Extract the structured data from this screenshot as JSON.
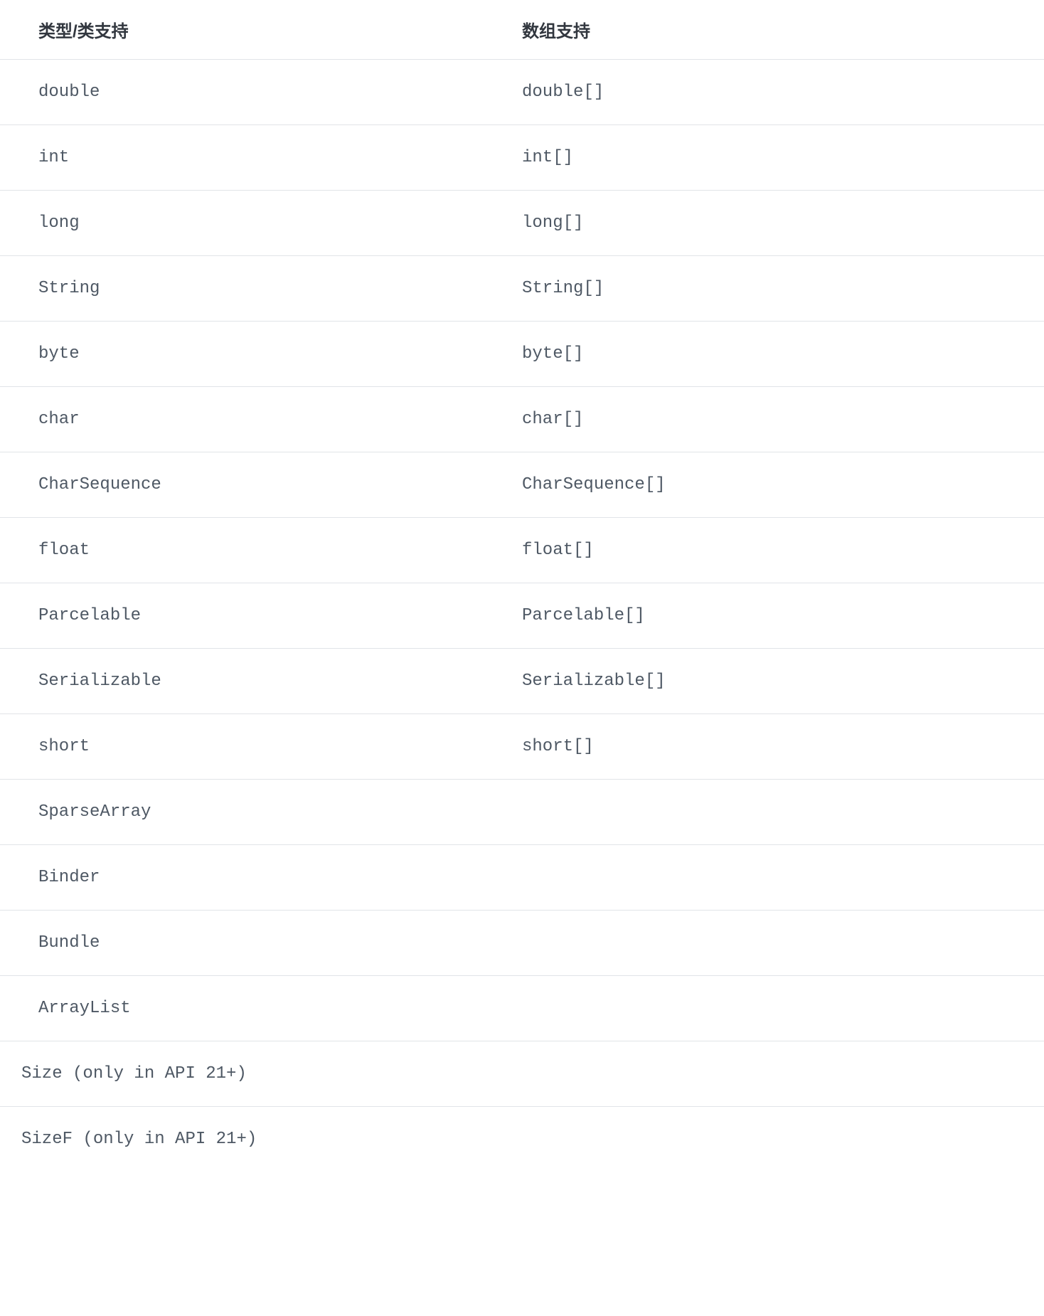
{
  "table": {
    "headers": {
      "type": "类型/类支持",
      "array": "数组支持"
    },
    "rows": [
      {
        "type": "double",
        "array": "double[]"
      },
      {
        "type": "int",
        "array": "int[]"
      },
      {
        "type": "long",
        "array": "long[]"
      },
      {
        "type": "String",
        "array": "String[]"
      },
      {
        "type": "byte",
        "array": "byte[]"
      },
      {
        "type": "char",
        "array": "char[]"
      },
      {
        "type": "CharSequence",
        "array": "CharSequence[]"
      },
      {
        "type": "float",
        "array": "float[]"
      },
      {
        "type": "Parcelable",
        "array": "Parcelable[]"
      },
      {
        "type": "Serializable",
        "array": "Serializable[]"
      },
      {
        "type": "short",
        "array": "short[]"
      },
      {
        "type": "SparseArray",
        "array": ""
      },
      {
        "type": "Binder",
        "array": ""
      },
      {
        "type": "Bundle",
        "array": ""
      },
      {
        "type": "ArrayList",
        "array": ""
      }
    ],
    "extraRows": [
      {
        "type": "Size (only in API 21+)"
      },
      {
        "type": "SizeF (only in API 21+)"
      }
    ]
  }
}
